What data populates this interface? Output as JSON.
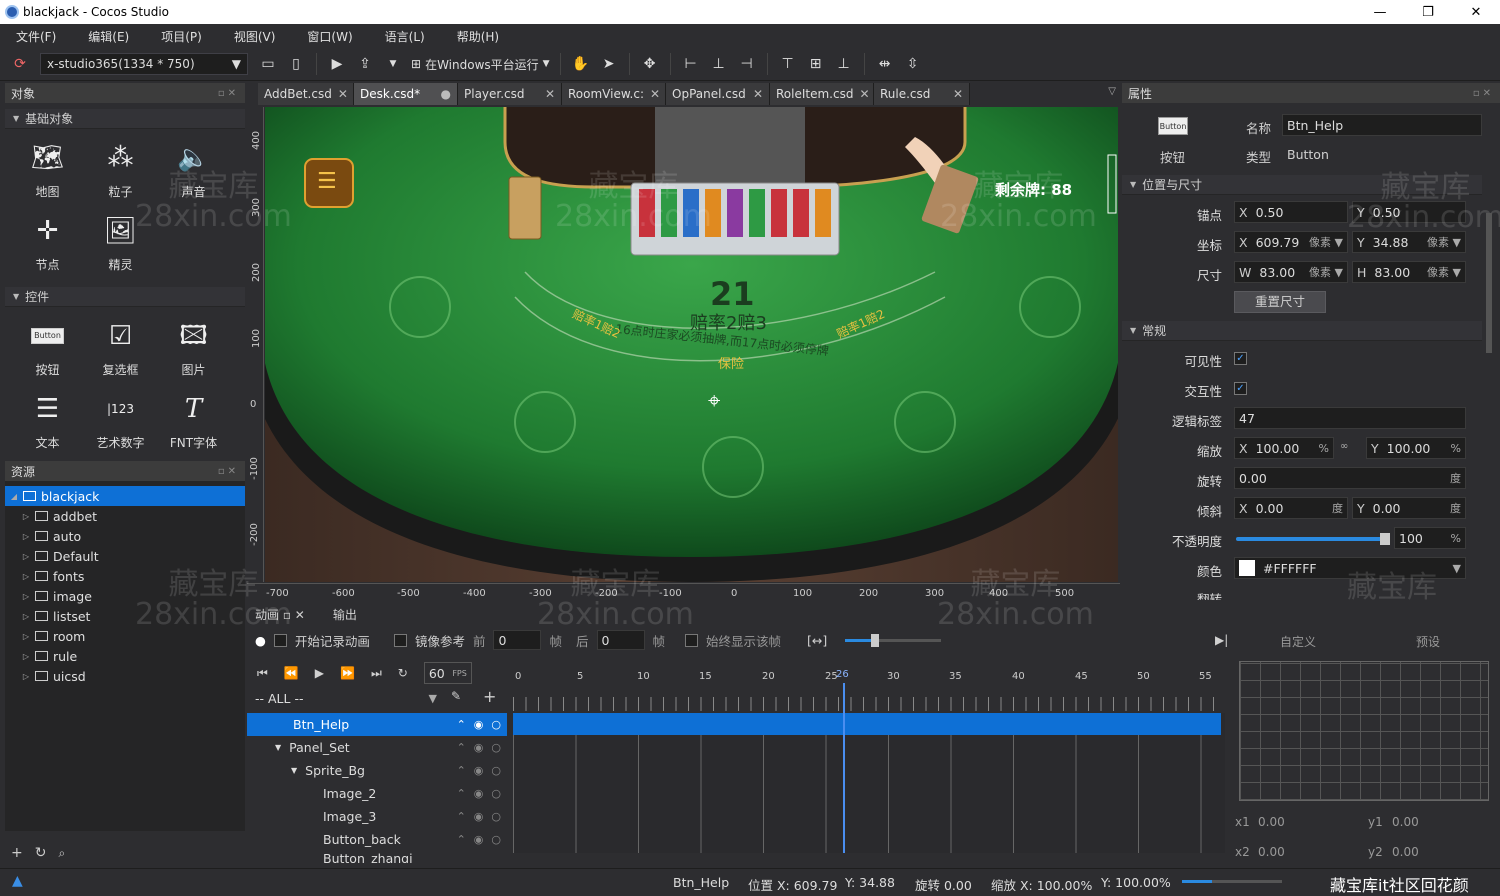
{
  "window": {
    "title": "blackjack - Cocos Studio",
    "minimize": "—",
    "maximize": "❐",
    "close": "✕"
  },
  "menu": [
    "文件(F)",
    "编辑(E)",
    "项目(P)",
    "视图(V)",
    "窗口(W)",
    "语言(L)",
    "帮助(H)"
  ],
  "toolbar": {
    "resolution": "x-studio365(1334 * 750)",
    "run_label": "在Windows平台运行"
  },
  "left": {
    "objects_title": "对象",
    "basic_section": "基础对象",
    "basic_items": [
      {
        "label": "地图",
        "icon": "map-icon"
      },
      {
        "label": "粒子",
        "icon": "particle-icon"
      },
      {
        "label": "声音",
        "icon": "sound-icon"
      },
      {
        "label": "节点",
        "icon": "node-icon"
      },
      {
        "label": "精灵",
        "icon": "sprite-icon"
      }
    ],
    "controls_section": "控件",
    "control_items": [
      {
        "label": "按钮",
        "icon": "button-icon"
      },
      {
        "label": "复选框",
        "icon": "checkbox-icon"
      },
      {
        "label": "图片",
        "icon": "image-icon"
      },
      {
        "label": "文本",
        "icon": "text-icon"
      },
      {
        "label": "艺术数字",
        "icon": "atlas-number-icon"
      },
      {
        "label": "FNT字体",
        "icon": "font-icon"
      }
    ],
    "resources_title": "资源",
    "tree": [
      "blackjack",
      "addbet",
      "auto",
      "Default",
      "fonts",
      "image",
      "listset",
      "room",
      "rule",
      "uicsd"
    ]
  },
  "tabs": [
    {
      "label": "AddBet.csd"
    },
    {
      "label": "Desk.csd*"
    },
    {
      "label": "Player.csd"
    },
    {
      "label": "RoomView.c:"
    },
    {
      "label": "OpPanel.csd"
    },
    {
      "label": "RoleItem.csd"
    },
    {
      "label": "Rule.csd"
    }
  ],
  "scene": {
    "remaining_label": "剩余牌: 88",
    "score": "21",
    "odds": "赔率2赔3",
    "rule_text": "16点时庄家必须抽牌,而17点时必须停牌",
    "left_pay": "赔率1赔2",
    "right_pay": "赔率1赔2",
    "insurance": "保险"
  },
  "ruler_v": [
    "400",
    "300",
    "200",
    "100",
    "0",
    "-100",
    "-200"
  ],
  "ruler_h": [
    "-700",
    "-600",
    "-500",
    "-400",
    "-300",
    "-200",
    "-100",
    "0",
    "100",
    "200",
    "300",
    "400",
    "500"
  ],
  "props": {
    "title": "属性",
    "widget_label": "按钮",
    "widget_icon_text": "Button",
    "name_label": "名称",
    "name_value": "Btn_Help",
    "type_label": "类型",
    "type_value": "Button",
    "pos_section": "位置与尺寸",
    "anchor_label": "锚点",
    "anchor_x": "0.50",
    "anchor_y": "0.50",
    "coord_label": "坐标",
    "coord_x": "609.79",
    "coord_y": "34.88",
    "unit_px": "像素",
    "size_label": "尺寸",
    "size_w": "83.00",
    "size_h": "83.00",
    "reset_btn": "重置尺寸",
    "general_section": "常规",
    "visible_label": "可见性",
    "interactive_label": "交互性",
    "tag_label": "逻辑标签",
    "tag_value": "47",
    "scale_label": "缩放",
    "scale_x": "100.00",
    "scale_y": "100.00",
    "rotate_label": "旋转",
    "rotate_value": "0.00",
    "unit_deg": "度",
    "skew_label": "倾斜",
    "skew_x": "0.00",
    "skew_y": "0.00",
    "opacity_label": "不透明度",
    "opacity_value": "100",
    "color_label": "颜色",
    "color_value": "#FFFFFF",
    "flip_label": "翻转"
  },
  "anim": {
    "tab_anim": "动画",
    "tab_output": "输出",
    "record": "开始记录动画",
    "mirror": "镜像参考",
    "prev": "前",
    "prev_val": "0",
    "frame": "帧",
    "next": "后",
    "next_val": "0",
    "always_show": "始终显示该帧",
    "fps": "60",
    "fps_unit": "FPS",
    "filter": "-- ALL --",
    "timeline_ticks": [
      "0",
      "5",
      "10",
      "15",
      "20",
      "25",
      "30",
      "35",
      "40",
      "45",
      "50",
      "55"
    ],
    "current_frame": "26",
    "tracks": [
      "Btn_Help",
      "Panel_Set",
      "Sprite_Bg",
      "Image_2",
      "Image_3",
      "Button_back",
      "Button_zhangi"
    ],
    "curve_tab_custom": "自定义",
    "curve_tab_preset": "预设",
    "x1_label": "x1",
    "x1": "0.00",
    "y1_label": "y1",
    "y1": "0.00",
    "x2_label": "x2",
    "x2": "0.00",
    "y2_label": "y2",
    "y2": "0.00"
  },
  "status": {
    "name": "Btn_Help",
    "pos": "位置 X: 609.79",
    "pos_y": "Y: 34.88",
    "rotate": "旋转 0.00",
    "scale": "缩放 X: 100.00%",
    "scale_y": "Y: 100.00%"
  },
  "watermarks": [
    "藏宝库",
    "28xin.com"
  ],
  "corner_watermark": "藏宝库it社区回花颜"
}
